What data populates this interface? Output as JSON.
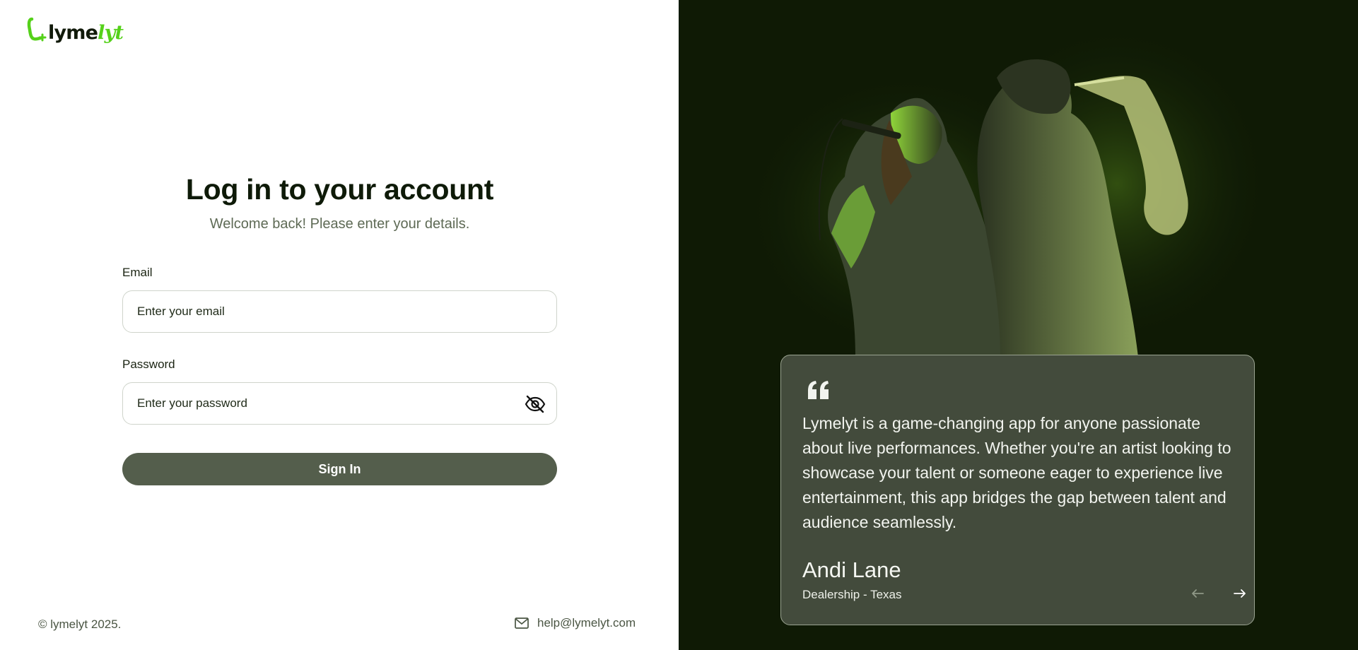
{
  "brand": {
    "logo_main": "lyme",
    "logo_accent": "lyt",
    "accent_color": "#55d11a"
  },
  "login": {
    "title": "Log in to your account",
    "subtitle": "Welcome back! Please enter your details.",
    "email_label": "Email",
    "email_placeholder": "Enter your email",
    "email_value": "",
    "password_label": "Password",
    "password_placeholder": "Enter your password",
    "password_value": "",
    "signin_label": "Sign In",
    "signin_color": "#545e4c"
  },
  "footer": {
    "copyright": "© lymelyt 2025.",
    "email": "help@lymelyt.com",
    "email_icon": "mail-icon"
  },
  "testimonial": {
    "quote": "Lymelyt is a game-changing app for anyone passionate about live performances. Whether you're an artist looking to showcase your talent or someone eager to experience live entertainment, this app bridges the gap between talent and audience seamlessly.",
    "author": "Andi Lane",
    "role": "Dealership - Texas",
    "prev_icon": "arrow-left-icon",
    "next_icon": "arrow-right-icon",
    "card_color": "#434b3c",
    "panel_color": "#0f1a05"
  }
}
